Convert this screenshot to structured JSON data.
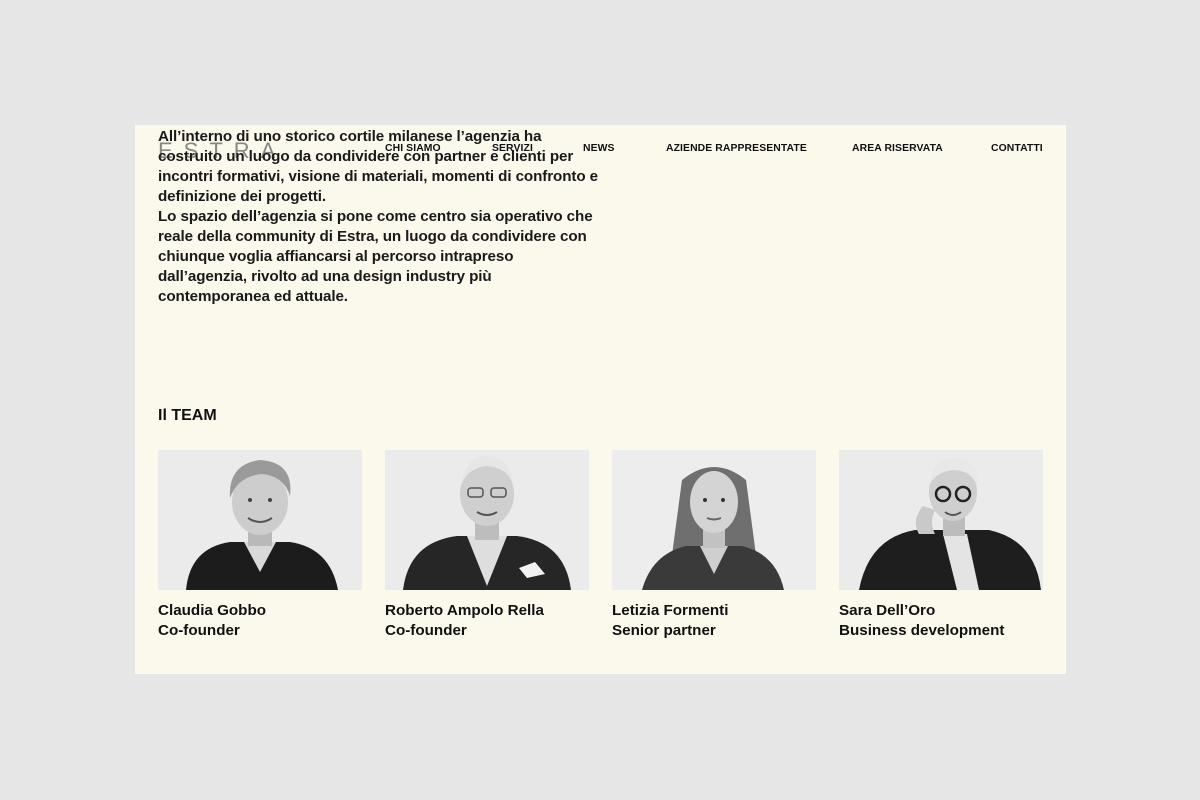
{
  "brand": {
    "logo": "ESTRA"
  },
  "nav": {
    "items": [
      {
        "label": "CHI SIAMO"
      },
      {
        "label": "SERVIZI"
      },
      {
        "label": "NEWS"
      },
      {
        "label": "AZIENDE RAPPRESENTATE"
      },
      {
        "label": "AREA RISERVATA"
      },
      {
        "label": "CONTATTI"
      }
    ]
  },
  "about": {
    "paragraphs": [
      "Design District, la destination d’eccellenza per il design. All’interno di uno storico cortile milanese l’agenzia ha costruito un luogo da condividere con partner e clienti per incontri formativi, visione di materiali, momenti di confronto e definizione dei progetti.",
      "Lo spazio dell’agenzia si pone come centro sia operativo che reale della community di Estra, un luogo da condividere con chiunque voglia affiancarsi al percorso intrapreso dall’agenzia, rivolto ad una design industry più contemporanea ed attuale."
    ]
  },
  "team": {
    "title": "Il TEAM",
    "members": [
      {
        "name": "Claudia Gobbo",
        "role": "Co-founder"
      },
      {
        "name": "Roberto Ampolo Rella",
        "role": "Co-founder"
      },
      {
        "name": "Letizia Formenti",
        "role": "Senior partner"
      },
      {
        "name": "Sara Dell’Oro",
        "role": "Business development"
      }
    ]
  },
  "colors": {
    "page_bg": "#e6e6e7",
    "panel_bg": "#fbf8ec",
    "text": "#111111"
  }
}
